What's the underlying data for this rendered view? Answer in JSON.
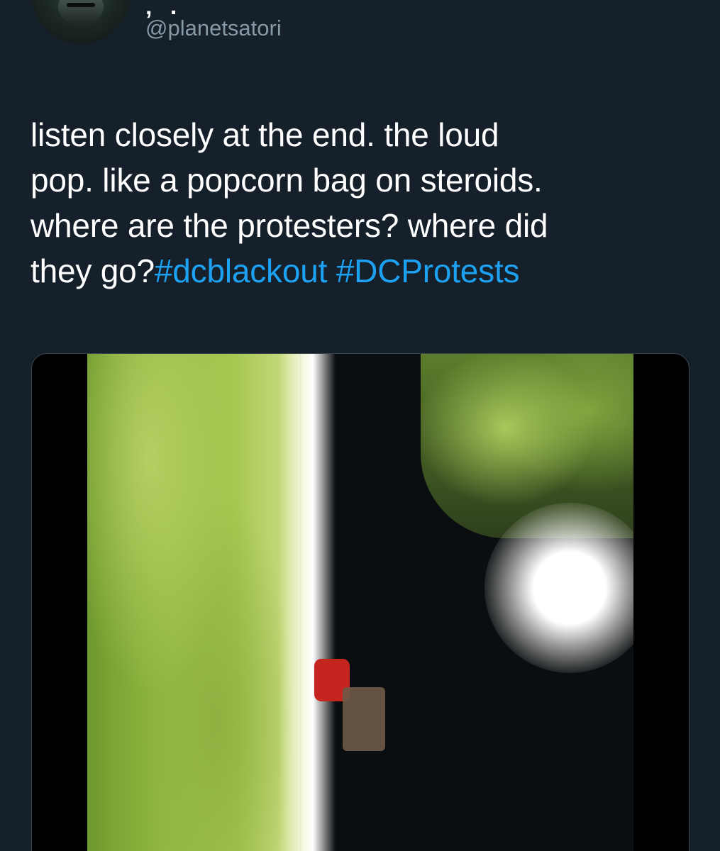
{
  "header": {
    "name_fragment": "‚ .",
    "handle": "@planetsatori"
  },
  "tweet": {
    "text_lines": [
      "listen closely at the end. the loud",
      "pop. like a popcorn bag on steroids.",
      "where are the protesters? where did",
      "they go?"
    ],
    "hashtags": [
      "#dcblackout",
      "#DCProtests"
    ]
  },
  "colors": {
    "background": "#15202b",
    "text": "#ffffff",
    "handle": "#8899a6",
    "hashtag": "#1da1f2"
  },
  "media": {
    "icon": "video-thumbnail"
  }
}
